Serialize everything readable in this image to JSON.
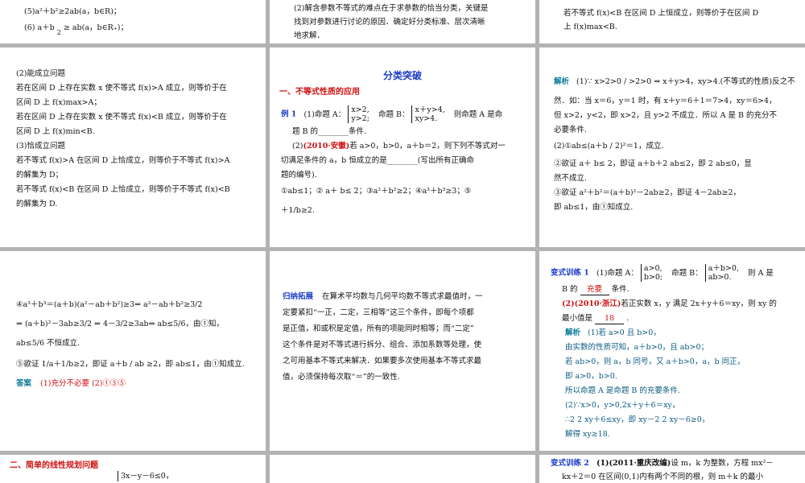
{
  "slide1": {
    "line1": "(5)a²＋b²≥2ab(a，b∈R)；",
    "line2": "(6) a＋b",
    "line2b": "2",
    "line2c": "≥  ab(a，b∈R₊)；"
  },
  "slide2": {
    "line1": "(2)解含参数不等式的难点在于求参数的恰当分类，关键是",
    "line2": "找到对参数进行讨论的原因．确定好分类标准、层次清晰",
    "line3": "地求解．"
  },
  "slide3": {
    "line1": "若不等式 f(x)<B 在区间 D 上恒成立，则等价于在区间 D",
    "line2": "上 f(x)max<B."
  },
  "slide4": {
    "lines": [
      "(2)能成立问题",
      "若在区间 D 上存在实数 x 使不等式 f(x)>A 成立，则等价于在",
      "区间 D 上 f(x)max>A；",
      "若在区间 D 上存在实数 x 使不等式 f(x)<B 成立，则等价于在",
      "区间 D 上 f(x)min<B.",
      "(3)恰成立问题",
      "若不等式 f(x)>A 在区间 D 上恰成立，则等价于不等式 f(x)>A",
      "的解集为 D；",
      "若不等式 f(x)<B 在区间 D 上恰成立，则等价于不等式 f(x)<B",
      "的解集为 D."
    ]
  },
  "slide5": {
    "title": "分类突破",
    "section": "一、不等式性质的应用",
    "ex_label": "例 1",
    "ex_line1a": "(1)命题 A：",
    "ex_sys1": [
      "x>2,",
      "y>2;"
    ],
    "ex_line1b": "命题 B：",
    "ex_sys2": [
      "x＋y>4,",
      "xy>4."
    ],
    "ex_line1c": "则命题 A 是命",
    "ex_line2": "题 B 的________条件.",
    "ex_line3a": "(2)",
    "ex_line3src": "(2010·安徽)",
    "ex_line3b": "若 a>0，b>0，a＋b＝2，则下列不等式对一",
    "ex_line4": "切满足条件的 a，b 恒成立的是________(写出所有正确命",
    "ex_line5": "题的编号).",
    "ex_line6": "①ab≤1；②  a＋  b≤  2；③a²＋b²≥2；④a³＋b³≥3；⑤",
    "ex_line7": "＋1/b≥2."
  },
  "slide6": {
    "label": "解析",
    "lines": [
      "(1)∵  x>2>0 / >2>0  ⇒ x＋y>4，xy>4.(不等式的性质)反之不",
      "然．如：当 x＝6，y＝1 时，有 x＋y＝6＋1＝7>4，xy＝6>4，",
      "但 x>2，y<2，即 x>2，且 y>2 不成立．所以 A 是 B 的充分不",
      "必要条件.",
      "(2)①ab≤(a＋b / 2)²＝1，成立.",
      "②欲证  a＋  b≤  2，即证 a＋b＋2  ab≤2，即 2  ab≤0，显",
      "然不成立.",
      "③欲证 a²＋b²＝(a＋b)²－2ab≥2，即证 4－2ab≥2，",
      "即 ab≤1，由①知成立."
    ]
  },
  "slide7": {
    "lines": [
      "④a³＋b³＝(a＋b)(a²－ab＋b²)≥3⇔ a²－ab＋b²≥3/2",
      "⇔ (a＋b)²－3ab≥3/2 ⇔ 4－3/2≥3ab⇔ ab≤5/6，由①知，",
      "ab≤5/6 不恒成立.",
      "⑤欲证 1/a＋1/b≥2，即证 a＋b / ab ≥2，即 ab≤1，由①知成立."
    ],
    "answer_label": "答案",
    "answer": "(1)充分不必要   (2)①③⑤"
  },
  "slide8": {
    "label": "归纳拓展",
    "lines": [
      "在算术平均数与几何平均数不等式求最值时，一",
      "定要紧扣“一正，二定，三相等”这三个条件，即每个项都",
      "是正值，和或积是定值，所有的项能同时相等；而“二定”",
      "这个条件是对不等式进行拆分、组合、添加系数等处理，使",
      "之可用基本不等式来解决．如果要多次使用基本不等式求最",
      "值，必须保持每次取“＝”的一致性."
    ]
  },
  "slide9": {
    "label": "变式训练 1",
    "q1a": "(1)命题 A：",
    "q1sys1": [
      "a>0,",
      "b>0;"
    ],
    "q1b": "命题 B：",
    "q1sys2": [
      "a＋b>0,",
      "ab>0."
    ],
    "q1c": "则 A 是",
    "q2a": "B 的",
    "q2ans": "充要",
    "q2b": "条件.",
    "q3src": "(2)(2010·浙江)",
    "q3": "若正实数 x，y 满足 2x＋y＋6＝xy，则 xy 的",
    "q4a": "最小值是",
    "q4ans": "18",
    "q4b": ".",
    "sol_label": "解析",
    "sol": [
      "(1)若 a>0 且 b>0，",
      "由实数的性质可知，a＋b>0，且 ab>0；",
      "若 ab>0，则 a，b 同号，又 a＋b>0，a，b 同正，",
      "即 a>0，b>0.",
      "所以命题 A 是命题 B 的充要条件.",
      "(2)∵x>0，y>0,2x＋y＋6＝xy，",
      "∴2  2  xy＋6≤xy，即 xy－2  2  xy－6≥0，",
      "解得 xy≥18."
    ]
  },
  "slide10": {
    "section": "二、简单的线性规划问题",
    "sys": "3x－y－6≤0，"
  },
  "slide12": {
    "label": "变式训练 2",
    "line1src": "(1)(2011·重庆改编)",
    "line1": "设 m，k 为整数，方程 mx²－",
    "line2": "kx＋2＝0 在区间(0,1)内有两个不同的根，则 m＋k 的最小"
  }
}
